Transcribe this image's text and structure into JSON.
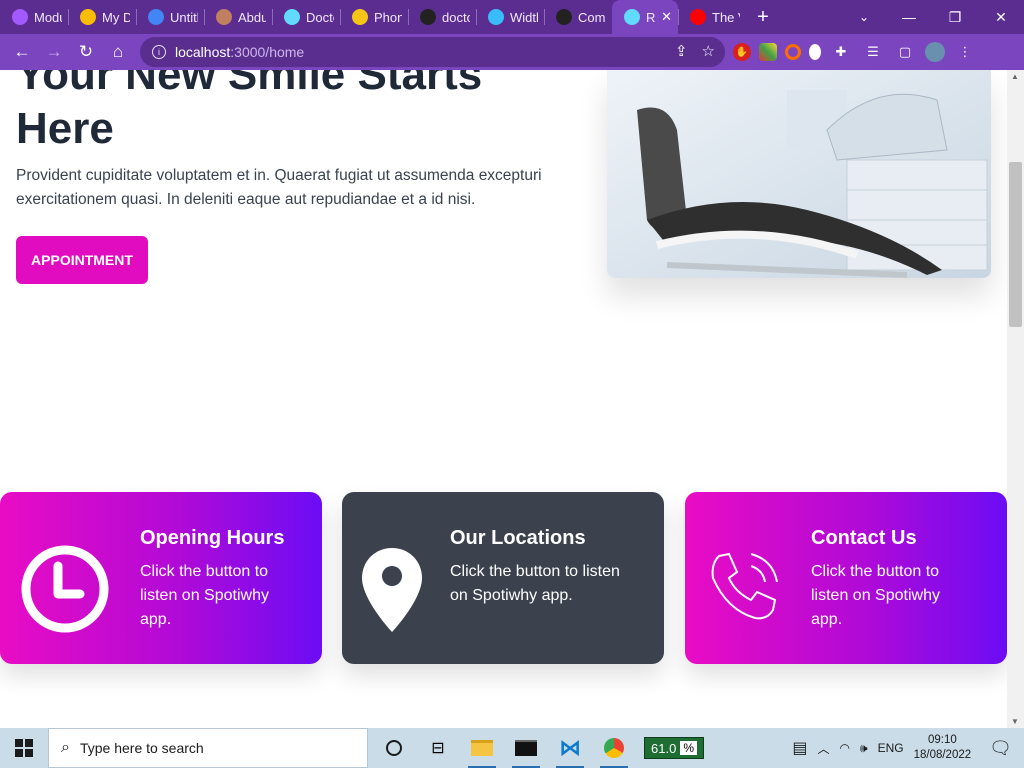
{
  "browser": {
    "tabs": [
      {
        "title": "Modu",
        "favicon": "figma-icon",
        "color": "#a259ff"
      },
      {
        "title": "My D",
        "favicon": "google-drive-icon",
        "color": "#fbbc04"
      },
      {
        "title": "Untitl",
        "favicon": "google-docs-icon",
        "color": "#4285f4"
      },
      {
        "title": "Abdu",
        "favicon": "avatar-icon",
        "color": "#c08060"
      },
      {
        "title": "Docto",
        "favicon": "react-icon",
        "color": "#61dafb"
      },
      {
        "title": "Phon",
        "favicon": "sunflower-icon",
        "color": "#f5c518"
      },
      {
        "title": "docto",
        "favicon": "github-icon",
        "color": "#222"
      },
      {
        "title": "Widtl",
        "favicon": "tailwind-icon",
        "color": "#38bdf8"
      },
      {
        "title": "Com",
        "favicon": "github-icon",
        "color": "#222"
      },
      {
        "title": "R",
        "favicon": "react-icon",
        "color": "#61dafb",
        "active": true
      },
      {
        "title": "The V",
        "favicon": "youtube-icon",
        "color": "#ff0000"
      }
    ],
    "new_tab": "+",
    "url_host": "localhost",
    "url_path": ":3000/home",
    "accent": "#7b45c0"
  },
  "hero": {
    "title": "Your New Smile Starts Here",
    "description": "Provident cupiditate voluptatem et in. Quaerat fugiat ut assumenda excepturi exercitationem quasi. In deleniti eaque aut repudiandae et a id nisi.",
    "button_label": "APPOINTMENT",
    "accent": "#e10cc0"
  },
  "cards": [
    {
      "title": "Opening Hours",
      "text": "Click the button to listen on Spotiwhy app.",
      "icon": "clock-icon",
      "style": "gradient"
    },
    {
      "title": "Our Locations",
      "text": "Click the button to listen on Spotiwhy app.",
      "icon": "location-pin-icon",
      "style": "dark"
    },
    {
      "title": "Contact Us",
      "text": "Click the button to listen on Spotiwhy app.",
      "icon": "phone-icon",
      "style": "gradient"
    }
  ],
  "taskbar": {
    "search_placeholder": "Type here to search",
    "battery_value": "61.0",
    "battery_unit": "%",
    "language": "ENG",
    "time": "09:10",
    "date": "18/08/2022"
  }
}
